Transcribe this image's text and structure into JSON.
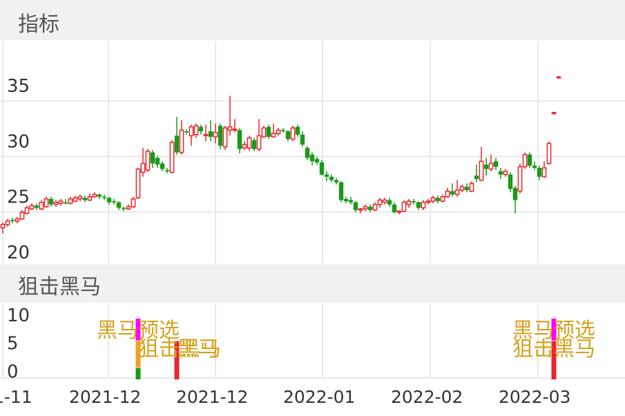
{
  "headers": {
    "main": "指标",
    "sub": "狙击黑马"
  },
  "colors": {
    "up": "#e8262b",
    "down": "#199a19",
    "grid": "#e8e8e8",
    "signal_text": "#d4a21c",
    "magenta": "#ff00ff",
    "orange": "#f0a020"
  },
  "chart_data": [
    {
      "type": "candlestick",
      "ylim": [
        19,
        39
      ],
      "yticks": [
        "35",
        "30",
        "25",
        "20"
      ],
      "xticks": [
        "1-11",
        "2021-12",
        "2021-12",
        "2022-01",
        "2022-02",
        "2022-03"
      ],
      "candles": [
        {
          "o": 22.2,
          "c": 22.5,
          "h": 22.7,
          "l": 21.7
        },
        {
          "o": 22.5,
          "c": 22.8,
          "h": 23.0,
          "l": 22.3
        },
        {
          "o": 22.9,
          "c": 22.8,
          "h": 23.1,
          "l": 22.6
        },
        {
          "o": 22.8,
          "c": 23.0,
          "h": 23.2,
          "l": 22.6
        },
        {
          "o": 23.0,
          "c": 23.6,
          "h": 23.8,
          "l": 22.9
        },
        {
          "o": 23.5,
          "c": 24.0,
          "h": 24.2,
          "l": 23.4
        },
        {
          "o": 23.9,
          "c": 24.2,
          "h": 24.4,
          "l": 23.8
        },
        {
          "o": 24.2,
          "c": 24.0,
          "h": 24.4,
          "l": 23.8
        },
        {
          "o": 23.9,
          "c": 24.5,
          "h": 24.7,
          "l": 23.8
        },
        {
          "o": 24.1,
          "c": 24.8,
          "h": 25.0,
          "l": 24.0
        },
        {
          "o": 24.8,
          "c": 24.3,
          "h": 25.0,
          "l": 24.1
        },
        {
          "o": 24.3,
          "c": 24.5,
          "h": 24.7,
          "l": 24.1
        },
        {
          "o": 24.4,
          "c": 24.6,
          "h": 24.8,
          "l": 24.2
        },
        {
          "o": 24.5,
          "c": 24.4,
          "h": 24.8,
          "l": 24.3
        },
        {
          "o": 24.4,
          "c": 24.8,
          "h": 25.0,
          "l": 24.3
        },
        {
          "o": 24.6,
          "c": 24.9,
          "h": 25.1,
          "l": 24.5
        },
        {
          "o": 24.8,
          "c": 25.0,
          "h": 25.2,
          "l": 24.6
        },
        {
          "o": 24.9,
          "c": 24.7,
          "h": 25.1,
          "l": 24.5
        },
        {
          "o": 24.7,
          "c": 25.0,
          "h": 25.3,
          "l": 24.6
        },
        {
          "o": 25.0,
          "c": 25.2,
          "h": 25.4,
          "l": 24.9
        },
        {
          "o": 25.2,
          "c": 25.0,
          "h": 25.3,
          "l": 24.8
        },
        {
          "o": 25.0,
          "c": 24.9,
          "h": 25.2,
          "l": 24.7
        },
        {
          "o": 24.9,
          "c": 24.5,
          "h": 25.0,
          "l": 24.3
        },
        {
          "o": 24.6,
          "c": 24.5,
          "h": 24.8,
          "l": 24.3
        },
        {
          "o": 24.5,
          "c": 24.0,
          "h": 24.6,
          "l": 23.8
        },
        {
          "o": 24.0,
          "c": 23.9,
          "h": 24.1,
          "l": 23.7
        },
        {
          "o": 23.9,
          "c": 24.1,
          "h": 24.3,
          "l": 23.8
        },
        {
          "o": 24.1,
          "c": 24.8,
          "h": 25.0,
          "l": 24.0
        },
        {
          "o": 24.9,
          "c": 27.5,
          "h": 27.6,
          "l": 24.8
        },
        {
          "o": 27.2,
          "c": 28.0,
          "h": 29.4,
          "l": 26.8
        },
        {
          "o": 27.4,
          "c": 29.1,
          "h": 29.3,
          "l": 27.2
        },
        {
          "o": 29.0,
          "c": 28.0,
          "h": 29.2,
          "l": 27.6
        },
        {
          "o": 28.5,
          "c": 27.9,
          "h": 28.7,
          "l": 27.6
        },
        {
          "o": 28.0,
          "c": 27.5,
          "h": 28.2,
          "l": 27.3
        },
        {
          "o": 27.4,
          "c": 27.3,
          "h": 27.6,
          "l": 27.1
        },
        {
          "o": 27.2,
          "c": 29.9,
          "h": 30.1,
          "l": 27.1
        },
        {
          "o": 30.5,
          "c": 29.0,
          "h": 32.2,
          "l": 28.8
        },
        {
          "o": 29.0,
          "c": 31.0,
          "h": 31.9,
          "l": 28.8
        },
        {
          "o": 30.9,
          "c": 30.8,
          "h": 31.1,
          "l": 30.6
        },
        {
          "o": 30.5,
          "c": 31.3,
          "h": 31.5,
          "l": 29.6
        },
        {
          "o": 30.6,
          "c": 31.4,
          "h": 31.6,
          "l": 30.3
        },
        {
          "o": 31.3,
          "c": 30.9,
          "h": 31.5,
          "l": 30.6
        },
        {
          "o": 30.6,
          "c": 30.6,
          "h": 31.5,
          "l": 30.0
        },
        {
          "o": 30.9,
          "c": 30.4,
          "h": 31.9,
          "l": 30.0
        },
        {
          "o": 30.4,
          "c": 30.8,
          "h": 31.6,
          "l": 29.8
        },
        {
          "o": 31.4,
          "c": 29.6,
          "h": 31.6,
          "l": 29.3
        },
        {
          "o": 29.5,
          "c": 31.2,
          "h": 31.4,
          "l": 29.2
        },
        {
          "o": 31.0,
          "c": 31.3,
          "h": 34.1,
          "l": 30.5
        },
        {
          "o": 31.1,
          "c": 31.1,
          "h": 32.0,
          "l": 30.8
        },
        {
          "o": 31.0,
          "c": 29.3,
          "h": 31.2,
          "l": 28.9
        },
        {
          "o": 29.4,
          "c": 29.7,
          "h": 30.0,
          "l": 29.2
        },
        {
          "o": 29.4,
          "c": 30.3,
          "h": 30.5,
          "l": 29.1
        },
        {
          "o": 30.1,
          "c": 29.3,
          "h": 30.3,
          "l": 29.1
        },
        {
          "o": 29.3,
          "c": 30.5,
          "h": 32.0,
          "l": 29.1
        },
        {
          "o": 30.4,
          "c": 31.2,
          "h": 31.4,
          "l": 30.3
        },
        {
          "o": 31.3,
          "c": 30.4,
          "h": 31.5,
          "l": 30.2
        },
        {
          "o": 30.4,
          "c": 30.7,
          "h": 31.6,
          "l": 30.3
        },
        {
          "o": 30.7,
          "c": 31.0,
          "h": 31.2,
          "l": 30.5
        },
        {
          "o": 31.0,
          "c": 30.9,
          "h": 31.2,
          "l": 30.8
        },
        {
          "o": 30.9,
          "c": 30.2,
          "h": 31.0,
          "l": 30.0
        },
        {
          "o": 30.2,
          "c": 31.2,
          "h": 31.4,
          "l": 30.0
        },
        {
          "o": 31.3,
          "c": 30.6,
          "h": 31.5,
          "l": 30.4
        },
        {
          "o": 30.6,
          "c": 29.7,
          "h": 30.9,
          "l": 29.5
        },
        {
          "o": 29.4,
          "c": 28.5,
          "h": 29.6,
          "l": 28.3
        },
        {
          "o": 28.8,
          "c": 28.2,
          "h": 29.0,
          "l": 27.8
        },
        {
          "o": 28.4,
          "c": 28.1,
          "h": 28.6,
          "l": 27.9
        },
        {
          "o": 28.1,
          "c": 27.0,
          "h": 28.3,
          "l": 26.9
        },
        {
          "o": 27.0,
          "c": 26.8,
          "h": 27.3,
          "l": 26.4
        },
        {
          "o": 26.8,
          "c": 26.5,
          "h": 27.0,
          "l": 26.3
        },
        {
          "o": 26.5,
          "c": 26.3,
          "h": 26.7,
          "l": 26.1
        },
        {
          "o": 26.3,
          "c": 24.7,
          "h": 26.4,
          "l": 24.5
        },
        {
          "o": 24.8,
          "c": 24.6,
          "h": 25.0,
          "l": 24.4
        },
        {
          "o": 24.7,
          "c": 24.5,
          "h": 25.0,
          "l": 24.3
        },
        {
          "o": 24.5,
          "c": 23.8,
          "h": 24.6,
          "l": 23.6
        },
        {
          "o": 23.8,
          "c": 23.9,
          "h": 24.0,
          "l": 23.5
        },
        {
          "o": 23.9,
          "c": 24.1,
          "h": 24.3,
          "l": 23.7
        },
        {
          "o": 24.1,
          "c": 23.8,
          "h": 24.3,
          "l": 23.6
        },
        {
          "o": 23.8,
          "c": 24.3,
          "h": 24.5,
          "l": 23.7
        },
        {
          "o": 24.3,
          "c": 24.7,
          "h": 24.9,
          "l": 24.0
        },
        {
          "o": 24.5,
          "c": 24.7,
          "h": 24.9,
          "l": 24.3
        },
        {
          "o": 24.7,
          "c": 24.3,
          "h": 24.9,
          "l": 24.1
        },
        {
          "o": 24.3,
          "c": 23.6,
          "h": 24.5,
          "l": 23.5
        },
        {
          "o": 23.6,
          "c": 23.7,
          "h": 23.8,
          "l": 23.4
        },
        {
          "o": 23.7,
          "c": 24.5,
          "h": 24.7,
          "l": 23.6
        },
        {
          "o": 24.3,
          "c": 24.6,
          "h": 24.8,
          "l": 24.0
        },
        {
          "o": 24.6,
          "c": 24.5,
          "h": 24.8,
          "l": 24.3
        },
        {
          "o": 24.5,
          "c": 24.0,
          "h": 24.6,
          "l": 23.8
        },
        {
          "o": 24.0,
          "c": 24.5,
          "h": 24.7,
          "l": 23.8
        },
        {
          "o": 24.5,
          "c": 24.6,
          "h": 24.8,
          "l": 24.3
        },
        {
          "o": 24.6,
          "c": 24.9,
          "h": 25.1,
          "l": 24.4
        },
        {
          "o": 24.9,
          "c": 24.6,
          "h": 25.1,
          "l": 24.4
        },
        {
          "o": 24.6,
          "c": 25.0,
          "h": 25.2,
          "l": 24.5
        },
        {
          "o": 25.0,
          "c": 25.5,
          "h": 25.8,
          "l": 24.9
        },
        {
          "o": 25.5,
          "c": 25.2,
          "h": 26.2,
          "l": 25.0
        },
        {
          "o": 25.2,
          "c": 25.6,
          "h": 26.5,
          "l": 25.0
        },
        {
          "o": 25.6,
          "c": 25.9,
          "h": 26.1,
          "l": 25.4
        },
        {
          "o": 25.9,
          "c": 25.6,
          "h": 26.2,
          "l": 25.4
        },
        {
          "o": 25.5,
          "c": 26.2,
          "h": 26.4,
          "l": 25.4
        },
        {
          "o": 26.9,
          "c": 26.6,
          "h": 27.9,
          "l": 26.3
        },
        {
          "o": 26.5,
          "c": 28.2,
          "h": 29.5,
          "l": 26.4
        },
        {
          "o": 27.9,
          "c": 27.5,
          "h": 28.5,
          "l": 26.9
        },
        {
          "o": 27.5,
          "c": 28.0,
          "h": 28.8,
          "l": 27.3
        },
        {
          "o": 28.2,
          "c": 27.7,
          "h": 28.5,
          "l": 27.4
        },
        {
          "o": 27.3,
          "c": 27.0,
          "h": 27.6,
          "l": 26.6
        },
        {
          "o": 27.0,
          "c": 27.3,
          "h": 27.5,
          "l": 26.8
        },
        {
          "o": 27.0,
          "c": 25.7,
          "h": 27.2,
          "l": 25.4
        },
        {
          "o": 25.8,
          "c": 24.7,
          "h": 26.0,
          "l": 23.5
        },
        {
          "o": 25.5,
          "c": 27.7,
          "h": 28.0,
          "l": 25.3
        },
        {
          "o": 27.7,
          "c": 28.8,
          "h": 29.0,
          "l": 27.5
        },
        {
          "o": 28.8,
          "c": 27.8,
          "h": 29.0,
          "l": 27.6
        },
        {
          "o": 27.8,
          "c": 27.6,
          "h": 28.2,
          "l": 27.4
        },
        {
          "o": 27.6,
          "c": 26.8,
          "h": 27.8,
          "l": 26.5
        },
        {
          "o": 26.8,
          "c": 27.6,
          "h": 28.2,
          "l": 26.7
        },
        {
          "o": 28.0,
          "c": 29.8,
          "h": 30.0,
          "l": 27.9
        },
        {
          "o": 32.5,
          "c": 32.6,
          "h": 32.6,
          "l": 32.4
        },
        {
          "o": 35.8,
          "c": 35.8,
          "h": 35.9,
          "l": 35.7
        }
      ]
    },
    {
      "type": "bar",
      "title": "狙击黑马",
      "ylim": [
        -1.2,
        12
      ],
      "yticks": [
        "10",
        "5",
        "0"
      ],
      "markers": [
        {
          "index": 28,
          "magenta": [
            5.5,
            9.4
          ],
          "orange": [
            0.7,
            5.4
          ],
          "green": [
            -2.5,
            0.6
          ],
          "red": null
        },
        {
          "index": 36,
          "magenta": null,
          "orange": null,
          "green": null,
          "red": [
            -2.5,
            5.4
          ]
        },
        {
          "index": 114,
          "magenta": [
            5.5,
            9.4
          ],
          "orange": null,
          "green": null,
          "red": [
            -2.5,
            5.4
          ]
        }
      ],
      "labels": [
        {
          "text": "黑马预选",
          "index": 28
        },
        {
          "text": "狙击黑马",
          "index": 28
        },
        {
          "text": "黑马",
          "index": 36
        },
        {
          "text": "黑马预选",
          "index": 114
        },
        {
          "text": "狙击黑马",
          "index": 114
        }
      ]
    }
  ]
}
